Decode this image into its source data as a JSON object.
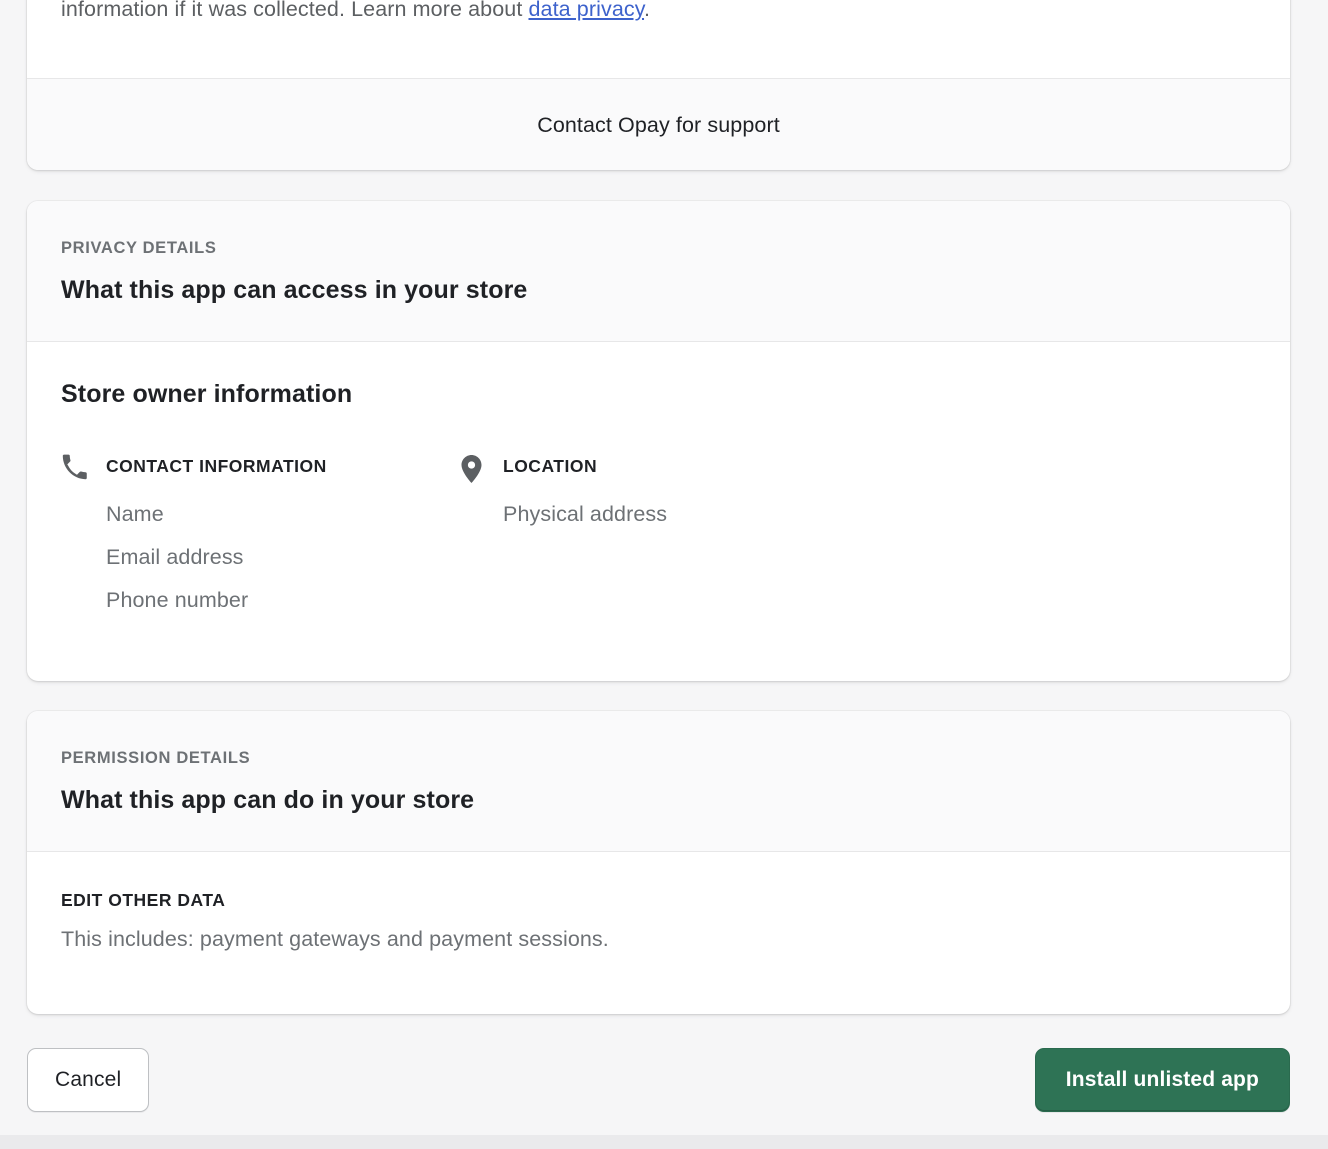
{
  "intro": {
    "text_before_link": "information if it was collected. Learn more about ",
    "link_label": "data privacy",
    "text_after_link": "."
  },
  "support": {
    "label": "Contact Opay for support"
  },
  "privacy_details": {
    "eyebrow": "PRIVACY DETAILS",
    "title": "What this app can access in your store",
    "subsection_title": "Store owner information",
    "columns": [
      {
        "icon": "phone-icon",
        "heading": "CONTACT INFORMATION",
        "items": [
          "Name",
          "Email address",
          "Phone number"
        ]
      },
      {
        "icon": "location-pin-icon",
        "heading": "LOCATION",
        "items": [
          "Physical address"
        ]
      }
    ]
  },
  "permission_details": {
    "eyebrow": "PERMISSION DETAILS",
    "title": "What this app can do in your store",
    "scopes": [
      {
        "name": "EDIT OTHER DATA",
        "description": "This includes: payment gateways and payment sessions."
      }
    ]
  },
  "actions": {
    "cancel_label": "Cancel",
    "install_label": "Install unlisted app"
  },
  "colors": {
    "page_background": "#F6F6F7",
    "card_background": "#FFFFFF",
    "card_header_background": "#FAFAFB",
    "primary_button": "#2E7355",
    "link": "#3D62CC",
    "muted_text": "#6D7175",
    "body_text": "#1F2125"
  }
}
